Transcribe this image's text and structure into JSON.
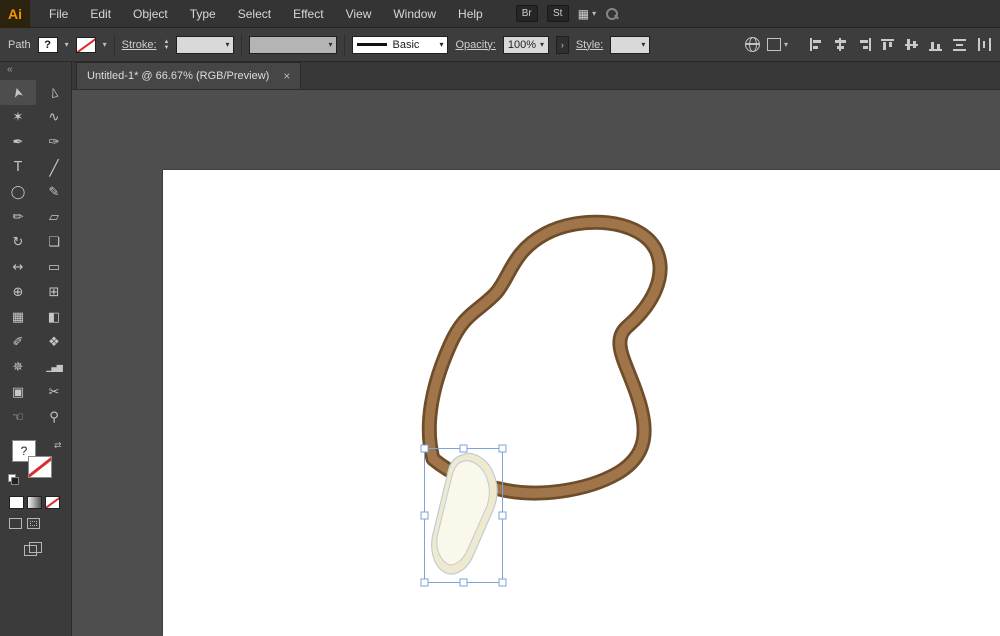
{
  "app": {
    "logo_text": "Ai",
    "menus": [
      "File",
      "Edit",
      "Object",
      "Type",
      "Select",
      "Effect",
      "View",
      "Window",
      "Help"
    ],
    "quick_buttons": [
      "Br",
      "St"
    ]
  },
  "control_bar": {
    "context_label": "Path",
    "fill_indicator": "?",
    "stroke_label": "Stroke:",
    "stroke_style_value": "Basic",
    "opacity_label": "Opacity:",
    "opacity_value": "100%",
    "style_label": "Style:",
    "panel_arrow": "›",
    "align_icons": [
      "align-left",
      "align-h-center",
      "align-right",
      "align-top",
      "align-v-center",
      "align-bottom",
      "distribute-v",
      "distribute-h"
    ]
  },
  "document_tab": {
    "title": "Untitled-1* @ 66.67% (RGB/Preview)",
    "close_label": "×"
  },
  "tool_panel": {
    "collapse_label": "«",
    "fill_indicator": "?",
    "tools": [
      {
        "name": "selection-tool",
        "glyph": "➤"
      },
      {
        "name": "direct-selection-tool",
        "glyph": "▻"
      },
      {
        "name": "magic-wand-tool",
        "glyph": "✶"
      },
      {
        "name": "lasso-tool",
        "glyph": "∿"
      },
      {
        "name": "pen-tool",
        "glyph": "✒"
      },
      {
        "name": "curvature-tool",
        "glyph": "✑"
      },
      {
        "name": "type-tool",
        "glyph": "T"
      },
      {
        "name": "line-segment-tool",
        "glyph": "╱"
      },
      {
        "name": "ellipse-tool",
        "glyph": "◯"
      },
      {
        "name": "paintbrush-tool",
        "glyph": "✎"
      },
      {
        "name": "pencil-tool",
        "glyph": "✏"
      },
      {
        "name": "eraser-tool",
        "glyph": "▱"
      },
      {
        "name": "rotate-tool",
        "glyph": "↻"
      },
      {
        "name": "scale-tool",
        "glyph": "❏"
      },
      {
        "name": "width-tool",
        "glyph": "↔"
      },
      {
        "name": "free-transform-tool",
        "glyph": "▭"
      },
      {
        "name": "shape-builder-tool",
        "glyph": "⊕"
      },
      {
        "name": "perspective-grid-tool",
        "glyph": "⊞"
      },
      {
        "name": "mesh-tool",
        "glyph": "▦"
      },
      {
        "name": "gradient-tool",
        "glyph": "◧"
      },
      {
        "name": "eyedropper-tool",
        "glyph": "✐"
      },
      {
        "name": "blend-tool",
        "glyph": "❖"
      },
      {
        "name": "symbol-sprayer-tool",
        "glyph": "✵"
      },
      {
        "name": "column-graph-tool",
        "glyph": "▁▄▆"
      },
      {
        "name": "artboard-tool",
        "glyph": "▣"
      },
      {
        "name": "slice-tool",
        "glyph": "✂"
      },
      {
        "name": "hand-tool",
        "glyph": "☜"
      },
      {
        "name": "zoom-tool",
        "glyph": "⚲"
      }
    ]
  },
  "colors": {
    "logo_orange": "#f79500",
    "none_red": "#d62f2f",
    "canvas_gray": "#4e4e4e",
    "artboard_white": "#ffffff"
  },
  "artwork": {
    "cord_outline": "#6e4e2a",
    "cord_fill": "#a1754a",
    "pendant_outer_fill": "#efe9cd",
    "pendant_inner_fill": "#faf8ea",
    "pendant_stroke": "#bfcbd9",
    "selection_blue": "#7da3d8"
  }
}
